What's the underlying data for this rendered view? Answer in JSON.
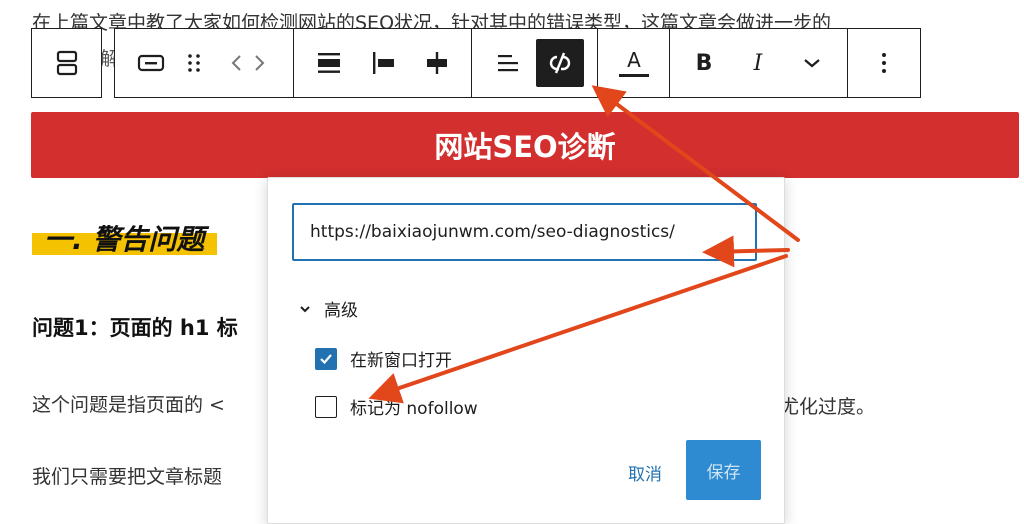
{
  "article": {
    "intro": "在上篇文章中教了大家如何检测网站的SEO状况，针对其中的错误类型，这篇文章会做进一步的",
    "masked_fragment": "解",
    "banner": "网站SEO诊断",
    "heading": "一. 警告问题",
    "q1_title": "问题1：页面的 h1 标",
    "para1_left": "这个问题是指页面的 <",
    "para1_right": "尤化过度。",
    "para2_left": "我们只需要把文章标题"
  },
  "toolbar": {
    "buttons": [
      {
        "name": "block-type-icon"
      },
      {
        "name": "button-block-icon"
      },
      {
        "name": "drag-handle-icon"
      },
      {
        "name": "move-arrows-icon"
      },
      {
        "name": "align-full-icon"
      },
      {
        "name": "align-left-icon"
      },
      {
        "name": "align-center-icon"
      },
      {
        "name": "justify-icon"
      },
      {
        "name": "unlink-icon",
        "active": true
      },
      {
        "name": "text-color-icon"
      },
      {
        "name": "bold-icon"
      },
      {
        "name": "italic-icon"
      },
      {
        "name": "more-formatting-icon"
      },
      {
        "name": "options-kebab-icon"
      }
    ],
    "bold_glyph": "B",
    "italic_glyph": "I",
    "color_glyph": "A"
  },
  "link_popover": {
    "url_value": "https://baixiaojunwm.com/seo-diagnostics/",
    "advanced_label": "高级",
    "options": [
      {
        "label": "在新窗口打开",
        "checked": true
      },
      {
        "label": "标记为 nofollow",
        "checked": false
      }
    ],
    "cancel_label": "取消",
    "save_label": "保存"
  },
  "colors": {
    "banner": "#d32f2f",
    "accent": "#2271b1",
    "save_button": "#2e8bd1",
    "highlight": "#f4c200",
    "annotation_arrow": "#e2461b"
  }
}
